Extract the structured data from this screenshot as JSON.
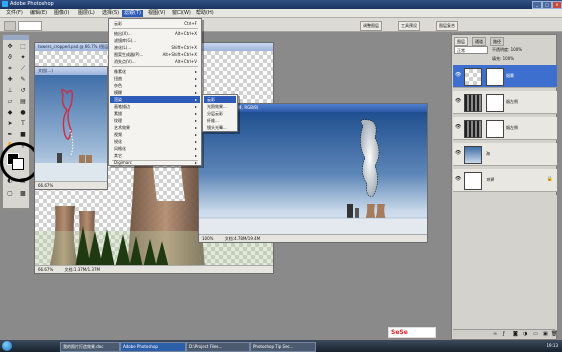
{
  "titlebar": {
    "title": "Adobe Photoshop"
  },
  "menubar": {
    "items": [
      {
        "label": "文件(F)"
      },
      {
        "label": "编辑(E)"
      },
      {
        "label": "图像(I)"
      },
      {
        "label": "图层(L)"
      },
      {
        "label": "选择(S)"
      },
      {
        "label": "滤镜(T)"
      },
      {
        "label": "视图(V)"
      },
      {
        "label": "窗口(W)"
      },
      {
        "label": "帮助(H)"
      }
    ],
    "active_index": 5
  },
  "optbar": {
    "btn1": "调整图层",
    "btn2": "工具预设",
    "btn3": "图层复合"
  },
  "filter_menu": {
    "items": [
      {
        "label": "云彩",
        "shortcut": "Ctrl+F"
      },
      {
        "label": "抽出(X)...",
        "shortcut": "Alt+Ctrl+X"
      },
      {
        "label": "滤镜库(G)..."
      },
      {
        "label": "液化(L)...",
        "shortcut": "Shift+Ctrl+X"
      },
      {
        "label": "图案生成器(P)...",
        "shortcut": "Alt+Shift+Ctrl+X"
      },
      {
        "label": "消失点(V)...",
        "shortcut": "Alt+Ctrl+V"
      },
      {
        "label": "像素化"
      },
      {
        "label": "扭曲"
      },
      {
        "label": "杂色"
      },
      {
        "label": "模糊"
      },
      {
        "label": "渲染"
      },
      {
        "label": "画笔描边"
      },
      {
        "label": "素描"
      },
      {
        "label": "纹理"
      },
      {
        "label": "艺术效果"
      },
      {
        "label": "视频"
      },
      {
        "label": "锐化"
      },
      {
        "label": "风格化"
      },
      {
        "label": "其它"
      },
      {
        "label": "Digimarc"
      }
    ],
    "highlight_index": 10
  },
  "render_submenu": {
    "items": [
      {
        "label": "云彩"
      },
      {
        "label": "光照效果..."
      },
      {
        "label": "分层云彩"
      },
      {
        "label": "纤维..."
      },
      {
        "label": "镜头光晕..."
      }
    ]
  },
  "doc_back": {
    "title": "towers_cropped.psd @ 66.7% (图层...)",
    "status": "66.67%",
    "status2": "文档:1.37M/1.37M"
  },
  "doc_mid": {
    "title": "文档(...)",
    "status": "66.67%"
  },
  "doc_main": {
    "title": "...psd @ 100% (背景, RGB/8)",
    "status": "100%",
    "status2": "文档:4.78M/19.4M"
  },
  "layers": {
    "tabs": [
      "图层",
      "通道",
      "路径"
    ],
    "mode": "正常",
    "opacity_label": "不透明度: 100%",
    "fill_label": "填充: 100%",
    "rows": [
      {
        "name": "烟雾",
        "selected": true
      },
      {
        "name": "烟左侧"
      },
      {
        "name": "烟左侧"
      },
      {
        "name": "海"
      },
      {
        "name": "背景"
      }
    ]
  },
  "taskbar": {
    "tasks": [
      "我的照片打造效果.doc",
      "Adobe Photoshop",
      "D:\\Project Files...",
      "Photoshop Tip Sec..."
    ],
    "clock": "19:13"
  },
  "colors": {
    "accent": "#2f5bb8",
    "sky_top": "#3f6ea8",
    "sky_bottom": "#c9d9ea"
  }
}
